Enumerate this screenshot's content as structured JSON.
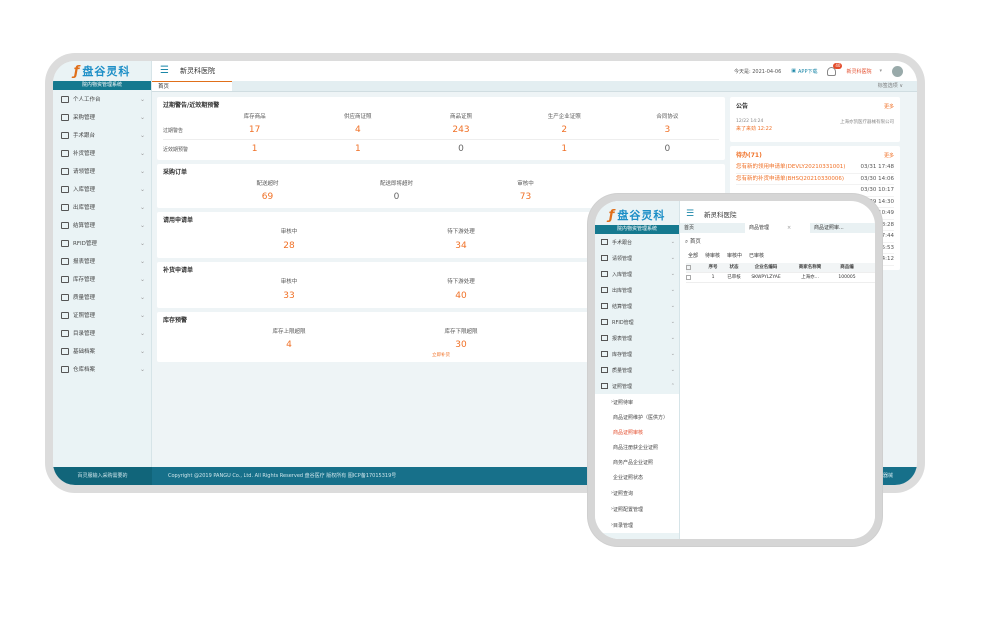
{
  "app": {
    "logo_cn": "盘谷灵科",
    "logo_en": "PANGU LINK",
    "system_name": "院内物资管理系统",
    "hospital": "新灵科医院"
  },
  "topbar": {
    "date": "今天是: 2021-04-06",
    "app_download": "APP下载",
    "badge_count": "40",
    "user": "新灵科医院"
  },
  "tabs": {
    "home": "首页",
    "right_action": "标签选项 ∨"
  },
  "sidebar": {
    "items": [
      {
        "label": "个人工作台"
      },
      {
        "label": "采购管理"
      },
      {
        "label": "手术跟台"
      },
      {
        "label": "补货管理"
      },
      {
        "label": "请领管理"
      },
      {
        "label": "入库管理"
      },
      {
        "label": "出库管理"
      },
      {
        "label": "结算管理"
      },
      {
        "label": "RFID管理"
      },
      {
        "label": "报表管理"
      },
      {
        "label": "库存管理"
      },
      {
        "label": "质量管理"
      },
      {
        "label": "证照管理"
      },
      {
        "label": "目录管理"
      },
      {
        "label": "基础档案"
      },
      {
        "label": "仓库档案"
      }
    ],
    "footer": "百灵服输入采购需要的"
  },
  "warning": {
    "title": "过期警告/近效期预警",
    "cols": [
      "库存商品",
      "供应商证照",
      "商品证照",
      "生产企业证照",
      "合同协议"
    ],
    "rows": [
      {
        "label": "过期警告",
        "values": [
          "17",
          "4",
          "243",
          "2",
          "3"
        ]
      },
      {
        "label": "近效期预警",
        "values": [
          "1",
          "1",
          "0",
          "1",
          "0"
        ]
      }
    ]
  },
  "purchase": {
    "title": "采购订单",
    "cols": [
      "配送超时",
      "配送即将超时",
      "审核中"
    ],
    "values": [
      "69",
      "0",
      "73"
    ]
  },
  "requisition": {
    "title": "请用申请单",
    "cols": [
      "审核中",
      "待下游处理"
    ],
    "values": [
      "28",
      "34"
    ]
  },
  "replenish": {
    "title": "补货申请单",
    "cols": [
      "审核中",
      "待下游处理"
    ],
    "values": [
      "33",
      "40"
    ]
  },
  "stock": {
    "title": "库存预警",
    "cols": [
      "库存上限超限",
      "库存下限超限"
    ],
    "values": [
      "4",
      "30"
    ],
    "note": "立即补货"
  },
  "notice": {
    "title": "公告",
    "more": "更多",
    "time": "12/22 14:24",
    "org": "上海亦凯医疗器械有限公司",
    "text": "来了来劲 12:22"
  },
  "todo": {
    "title": "待办(71)",
    "more": "更多",
    "items": [
      {
        "text": "您有新的领用申请单(DEVLY20210331001)",
        "date": "03/31 17:48"
      },
      {
        "text": "您有新的补货申请单(BHSQ20210330006)",
        "date": "03/30 14:06"
      },
      {
        "text": "",
        "date": "03/30 10:17"
      },
      {
        "text": "",
        "date": "3/29 14:30"
      },
      {
        "text": "",
        "date": "3/24 10:49"
      },
      {
        "text": "",
        "date": "/16 18:28"
      },
      {
        "text": "",
        "date": "/16 17:44"
      },
      {
        "text": "",
        "date": "/16 15:53"
      },
      {
        "text": "",
        "date": "/16 14:12"
      }
    ]
  },
  "footer": {
    "copyright": "Copyright @2019 PANGU Co., Ltd. All Rights Reserved 盘谷医疗 版权所有   图ICP备17015319号",
    "right": "盘谷医疗器械"
  },
  "mobile": {
    "sidebar_items": [
      {
        "label": "手术跟台"
      },
      {
        "label": "请领管理"
      },
      {
        "label": "入库管理"
      },
      {
        "label": "出库管理"
      },
      {
        "label": "结算管理"
      },
      {
        "label": "RFID管理"
      },
      {
        "label": "报表管理"
      },
      {
        "label": "库存管理"
      },
      {
        "label": "质量管理"
      },
      {
        "label": "证照管理"
      }
    ],
    "sub_group": "证照待审",
    "sub_items": [
      {
        "label": "商品证照维护（医供方）",
        "active": false
      },
      {
        "label": "商品证照审核",
        "active": true
      },
      {
        "label": "商品注册获企业证照",
        "active": false
      },
      {
        "label": "商务产品企业证照",
        "active": false
      },
      {
        "label": "企业证照状态",
        "active": false
      }
    ],
    "after_items": [
      {
        "label": "证照查询"
      },
      {
        "label": "证照配置管理"
      },
      {
        "label": "目录管理"
      }
    ],
    "tabs": [
      "首页",
      "商品管理",
      "商品证照审..."
    ],
    "search": "首页",
    "filters": [
      "全部",
      "待审核",
      "审核中",
      "已审核"
    ],
    "table_head": [
      "序号",
      "状态",
      "企业名编码",
      "商家名称简",
      "商品编"
    ],
    "table_row": [
      "1",
      "已审核",
      "SKWPYLZYAE",
      "上海亦...",
      "100005"
    ]
  }
}
